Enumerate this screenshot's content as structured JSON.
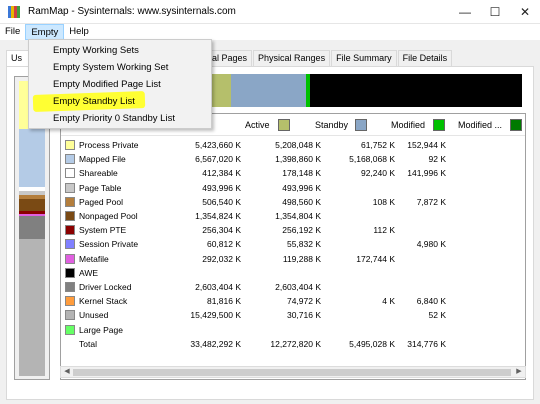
{
  "window": {
    "title": "RamMap - Sysinternals: www.sysinternals.com",
    "controls": {
      "minimize": "—",
      "maximize": "☐",
      "close": "✕"
    }
  },
  "menubar": [
    {
      "label": "File"
    },
    {
      "label": "Empty"
    },
    {
      "label": "Help"
    }
  ],
  "empty_menu": {
    "items": [
      "Empty Working Sets",
      "Empty System Working Set",
      "Empty Modified Page List",
      "Empty Standby List",
      "Empty Priority 0 Standby List"
    ],
    "highlighted_index": 3,
    "highlight_color": "#ffff33"
  },
  "tabs": [
    {
      "label": "Us",
      "selected": true
    },
    {
      "label": "al Pages"
    },
    {
      "label": "Physical Ranges"
    },
    {
      "label": "File Summary"
    },
    {
      "label": "File Details"
    }
  ],
  "table": {
    "columns": [
      {
        "label": "Active",
        "color": "#b5bf6b"
      },
      {
        "label": "Standby",
        "color": "#8aa6c6"
      },
      {
        "label": "Modified",
        "color": "#00c000"
      },
      {
        "label": "Modified ...",
        "color": "#007a00"
      }
    ],
    "rows": [
      {
        "name": "Process Private",
        "color": "#ffff99",
        "total": "5,423,660 K",
        "active": "5,208,048 K",
        "standby": "61,752 K",
        "modified": "152,944 K"
      },
      {
        "name": "Mapped File",
        "color": "#b4cbe6",
        "total": "6,567,020 K",
        "active": "1,398,860 K",
        "standby": "5,168,068 K",
        "modified": "92 K"
      },
      {
        "name": "Shareable",
        "color": "#ffffff",
        "total": "412,384 K",
        "active": "178,148 K",
        "standby": "92,240 K",
        "modified": "141,996 K"
      },
      {
        "name": "Page Table",
        "color": "#c8c8c8",
        "total": "493,996 K",
        "active": "493,996 K",
        "standby": "",
        "modified": ""
      },
      {
        "name": "Paged Pool",
        "color": "#b47e3c",
        "total": "506,540 K",
        "active": "498,560 K",
        "standby": "108 K",
        "modified": "7,872 K"
      },
      {
        "name": "Nonpaged Pool",
        "color": "#7a4a14",
        "total": "1,354,824 K",
        "active": "1,354,804 K",
        "standby": "",
        "modified": ""
      },
      {
        "name": "System PTE",
        "color": "#8b0000",
        "total": "256,304 K",
        "active": "256,192 K",
        "standby": "112 K",
        "modified": ""
      },
      {
        "name": "Session Private",
        "color": "#8080ff",
        "total": "60,812 K",
        "active": "55,832 K",
        "standby": "",
        "modified": "4,980 K"
      },
      {
        "name": "Metafile",
        "color": "#e060e0",
        "total": "292,032 K",
        "active": "119,288 K",
        "standby": "172,744 K",
        "modified": ""
      },
      {
        "name": "AWE",
        "color": "#000000",
        "total": "",
        "active": "",
        "standby": "",
        "modified": ""
      },
      {
        "name": "Driver Locked",
        "color": "#808080",
        "total": "2,603,404 K",
        "active": "2,603,404 K",
        "standby": "",
        "modified": ""
      },
      {
        "name": "Kernel Stack",
        "color": "#ff9c3c",
        "total": "81,816 K",
        "active": "74,972 K",
        "standby": "4 K",
        "modified": "6,840 K"
      },
      {
        "name": "Unused",
        "color": "#b4b4b4",
        "total": "15,429,500 K",
        "active": "30,716 K",
        "standby": "",
        "modified": "52 K"
      },
      {
        "name": "Large Page",
        "color": "#66ff66",
        "total": "",
        "active": "",
        "standby": "",
        "modified": ""
      },
      {
        "name": "Total",
        "color": "",
        "total": "33,482,292 K",
        "active": "12,272,820 K",
        "standby": "5,495,028 K",
        "modified": "314,776 K"
      }
    ]
  },
  "overview_bar": {
    "segments": [
      {
        "color": "#b5bf6b",
        "share": 0.367
      },
      {
        "color": "#8aa6c6",
        "share": 0.164
      },
      {
        "color": "#00c000",
        "share": 0.009
      },
      {
        "color": "#000000",
        "share": 0.46
      }
    ]
  },
  "usage_strip": {
    "segments": [
      {
        "color": "#ffff99",
        "share": 0.162
      },
      {
        "color": "#b4cbe6",
        "share": 0.196
      },
      {
        "color": "#ffffff",
        "share": 0.012
      },
      {
        "color": "#c8c8c8",
        "share": 0.015
      },
      {
        "color": "#b47e3c",
        "share": 0.015
      },
      {
        "color": "#7a4a14",
        "share": 0.04
      },
      {
        "color": "#8b0000",
        "share": 0.008
      },
      {
        "color": "#e060e0",
        "share": 0.009
      },
      {
        "color": "#808080",
        "share": 0.078
      },
      {
        "color": "#b4b4b4",
        "share": 0.461
      }
    ]
  }
}
